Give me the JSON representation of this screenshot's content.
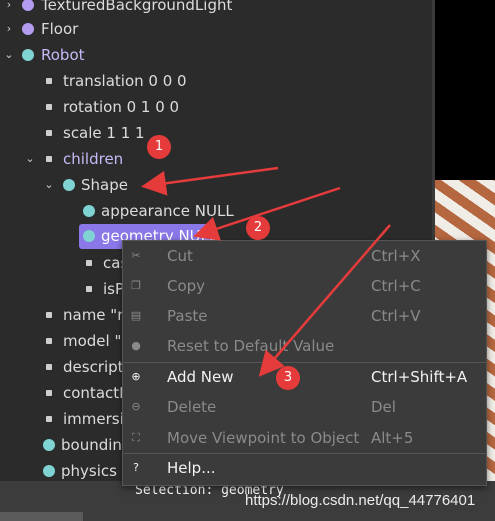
{
  "tree": {
    "rows": [
      {
        "label": "TexturedBackgroundLight"
      },
      {
        "label": "Floor"
      },
      {
        "label": "Robot"
      },
      {
        "label": "translation 0 0 0"
      },
      {
        "label": "rotation 0 1 0 0"
      },
      {
        "label": "scale 1 1 1"
      },
      {
        "label": "children"
      },
      {
        "label": "Shape"
      },
      {
        "label": "appearance NULL"
      },
      {
        "label": "geometry NULL"
      },
      {
        "label": "cas"
      },
      {
        "label": "isPi"
      },
      {
        "label": "name \"ro"
      },
      {
        "label": "model \"\""
      },
      {
        "label": "descripti"
      },
      {
        "label": "contactM"
      },
      {
        "label": "immersio"
      },
      {
        "label": "boundingO"
      },
      {
        "label": "physics N"
      }
    ]
  },
  "context_menu": {
    "items": [
      {
        "label": "Cut",
        "shortcut": "Ctrl+X",
        "icon": "cut-icon"
      },
      {
        "label": "Copy",
        "shortcut": "Ctrl+C",
        "icon": "copy-icon"
      },
      {
        "label": "Paste",
        "shortcut": "Ctrl+V",
        "icon": "paste-icon"
      },
      {
        "label": "Reset to Default Value",
        "shortcut": "",
        "icon": "reset-icon"
      },
      {
        "label": "Add New",
        "shortcut": "Ctrl+Shift+A",
        "icon": "add-icon"
      },
      {
        "label": "Delete",
        "shortcut": "Del",
        "icon": "delete-icon"
      },
      {
        "label": "Move Viewpoint to Object",
        "shortcut": "Alt+5",
        "icon": "viewpoint-icon"
      },
      {
        "label": "Help...",
        "shortcut": "",
        "icon": "help-icon"
      }
    ]
  },
  "status": {
    "selection": "Selection: geometry",
    "watermark": "https://blog.csdn.net/qq_44776401"
  },
  "annotations": [
    "1",
    "2",
    "3"
  ],
  "colors": {
    "accent": "#8a78e8",
    "annotation_red": "#e53b3b",
    "node_purple": "#b49cf0",
    "node_cyan": "#7fd3d3"
  }
}
